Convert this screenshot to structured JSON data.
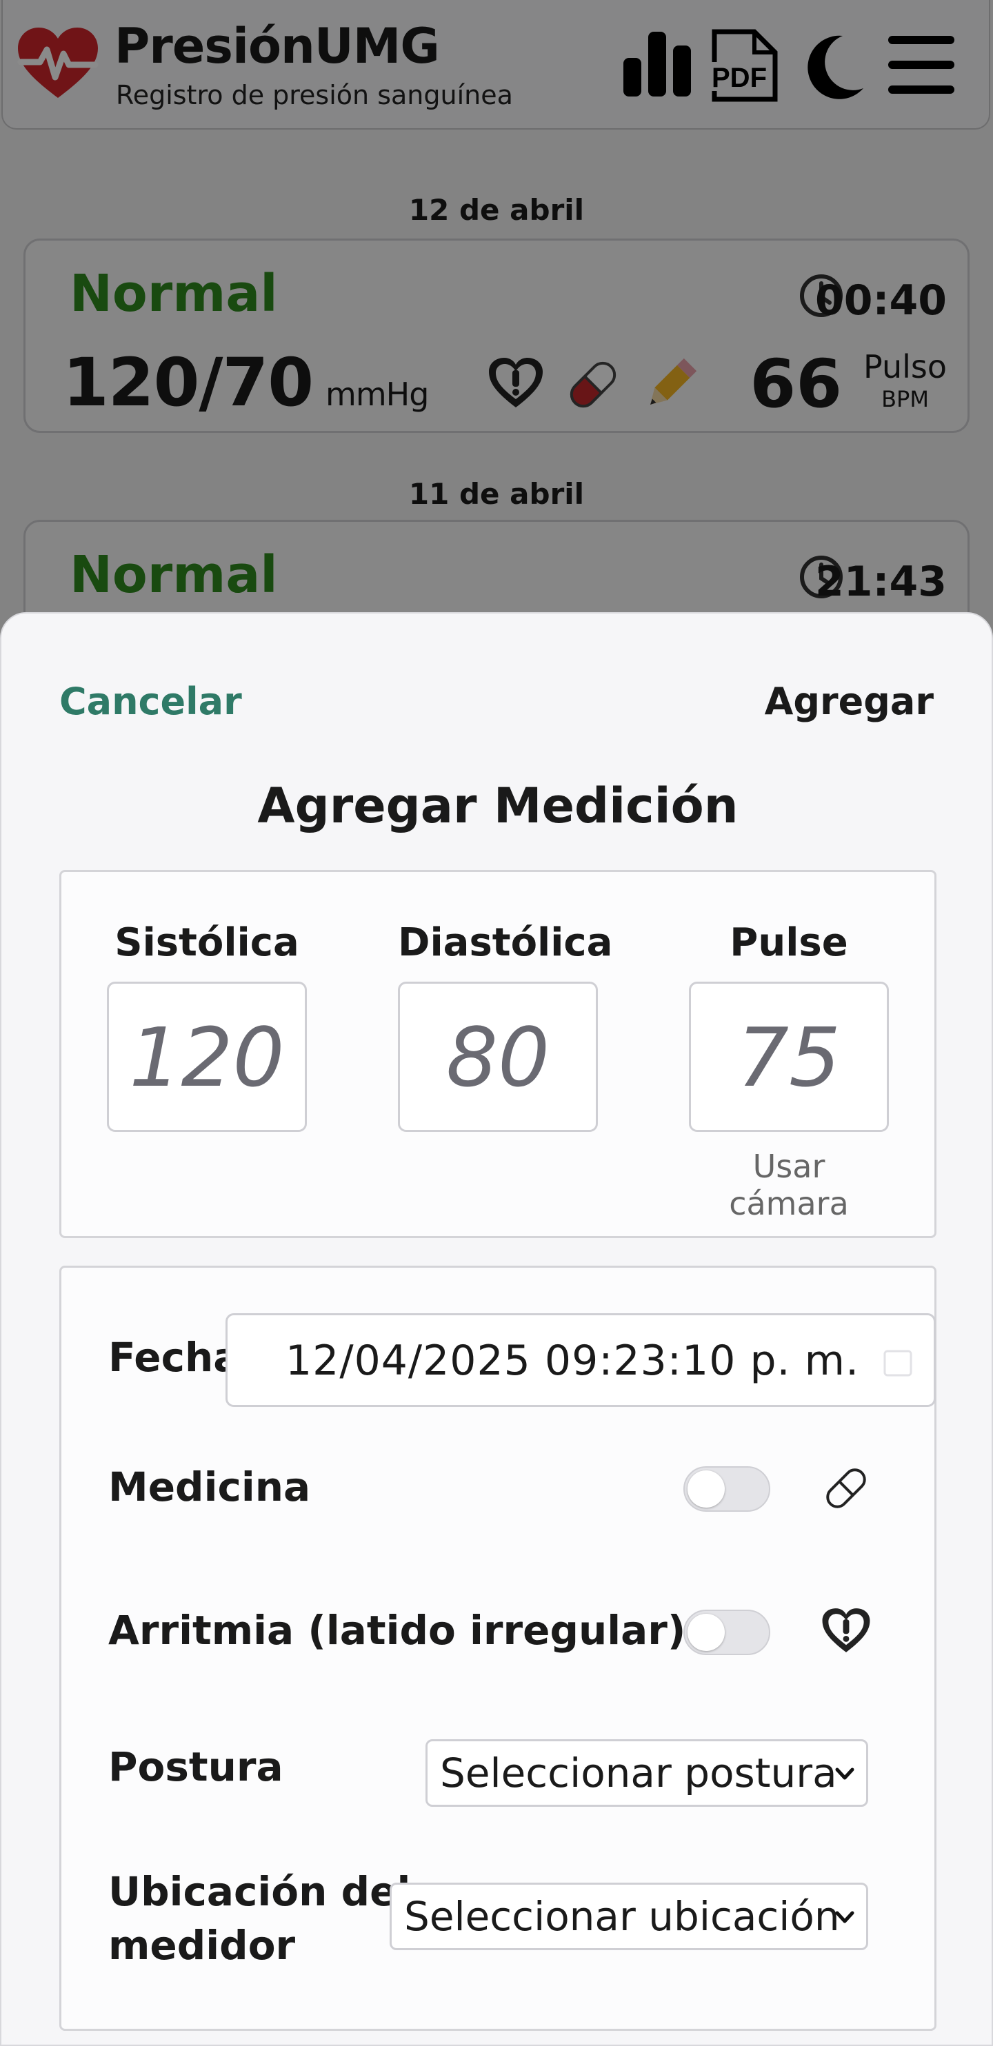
{
  "header": {
    "title": "PresiónUMG",
    "subtitle": "Registro de presión sanguínea",
    "icons": [
      "chart-icon",
      "pdf-icon",
      "moon-icon",
      "menu-icon"
    ],
    "pdf_label": "PDF"
  },
  "records": [
    {
      "date": "12 de abril",
      "status": "Normal",
      "time": "00:40",
      "bp": "120/70",
      "unit": "mmHg",
      "pulse": "66",
      "pulse_label": "Pulso",
      "pulse_unit": "BPM",
      "icons": [
        "arrhythmia-icon",
        "pill-icon",
        "pencil-icon"
      ]
    },
    {
      "date": "11 de abril",
      "status": "Normal",
      "time": "21:43"
    }
  ],
  "sheet": {
    "cancel_label": "Cancelar",
    "add_label": "Agregar",
    "title": "Agregar Medición",
    "systolic_label": "Sistólica",
    "systolic_placeholder": "120",
    "diastolic_label": "Diastólica",
    "diastolic_placeholder": "80",
    "pulse_label": "Pulse",
    "pulse_placeholder": "75",
    "camera_label": "Usar cámara",
    "date_label": "Fecha",
    "date_value": "12/04/2025 09:23:10 p. m.",
    "medicine_label": "Medicina",
    "medicine_on": false,
    "arrhythmia_label": "Arritmia (latido irregular)",
    "arrhythmia_on": false,
    "posture_label": "Postura",
    "posture_value": "Seleccionar postura",
    "location_label_line1": "Ubicación del",
    "location_label_line2": "medidor",
    "location_value": "Seleccionar ubicación"
  },
  "colors": {
    "status_normal": "#2f8a1f",
    "cancel": "#2f7a67",
    "logo_red": "#d0252c"
  }
}
